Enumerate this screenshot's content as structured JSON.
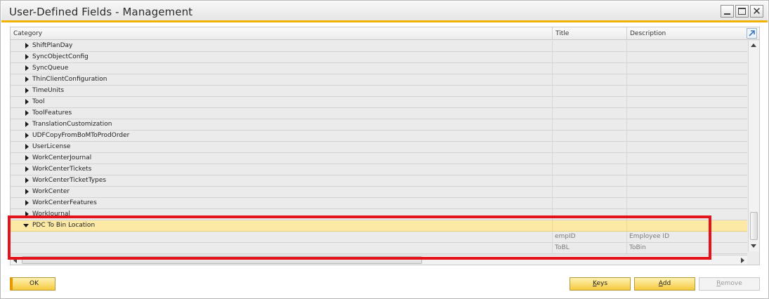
{
  "window": {
    "title": "User-Defined Fields - Management"
  },
  "grid": {
    "columns": [
      "Category",
      "Title",
      "Description"
    ],
    "rows": [
      {
        "label": "ShiftPlanDay",
        "title": "",
        "description": "",
        "level": 0,
        "expanded": false
      },
      {
        "label": "SyncObjectConfig",
        "title": "",
        "description": "",
        "level": 0,
        "expanded": false
      },
      {
        "label": "SyncQueue",
        "title": "",
        "description": "",
        "level": 0,
        "expanded": false
      },
      {
        "label": "ThinClientConfiguration",
        "title": "",
        "description": "",
        "level": 0,
        "expanded": false
      },
      {
        "label": "TimeUnits",
        "title": "",
        "description": "",
        "level": 0,
        "expanded": false
      },
      {
        "label": "Tool",
        "title": "",
        "description": "",
        "level": 0,
        "expanded": false
      },
      {
        "label": "ToolFeatures",
        "title": "",
        "description": "",
        "level": 0,
        "expanded": false
      },
      {
        "label": "TranslationCustomization",
        "title": "",
        "description": "",
        "level": 0,
        "expanded": false
      },
      {
        "label": "UDFCopyFromBoMToProdOrder",
        "title": "",
        "description": "",
        "level": 0,
        "expanded": false
      },
      {
        "label": "UserLicense",
        "title": "",
        "description": "",
        "level": 0,
        "expanded": false
      },
      {
        "label": "WorkCenterJournal",
        "title": "",
        "description": "",
        "level": 0,
        "expanded": false
      },
      {
        "label": "WorkCenterTickets",
        "title": "",
        "description": "",
        "level": 0,
        "expanded": false
      },
      {
        "label": "WorkCenterTicketTypes",
        "title": "",
        "description": "",
        "level": 0,
        "expanded": false
      },
      {
        "label": "WorkCenter",
        "title": "",
        "description": "",
        "level": 0,
        "expanded": false
      },
      {
        "label": "WorkCenterFeatures",
        "title": "",
        "description": "",
        "level": 0,
        "expanded": false
      },
      {
        "label": "WorkJournal",
        "title": "",
        "description": "",
        "level": 0,
        "expanded": false
      },
      {
        "label": "PDC To Bin Location",
        "title": "",
        "description": "",
        "level": 0,
        "expanded": true,
        "selected": true
      },
      {
        "label": "",
        "title": "empID",
        "description": "Employee ID",
        "level": 1
      },
      {
        "label": "",
        "title": "ToBL",
        "description": "ToBin",
        "level": 1
      }
    ]
  },
  "buttons": {
    "ok": "OK",
    "keys": "Keys",
    "keys_accel": "K",
    "keys_rest": "eys",
    "add_accel": "A",
    "add_rest": "dd",
    "remove_accel": "R",
    "remove_rest": "emove"
  },
  "colors": {
    "accent": "#f0b400",
    "selected_row": "#fce9a6",
    "highlight_box": "#e3121b",
    "button_fill": "#f5c93c"
  },
  "icons": [
    "minimize-icon",
    "maximize-icon",
    "close-icon",
    "expand-grid-icon",
    "collapsed-triangle-icon",
    "expanded-triangle-icon"
  ]
}
